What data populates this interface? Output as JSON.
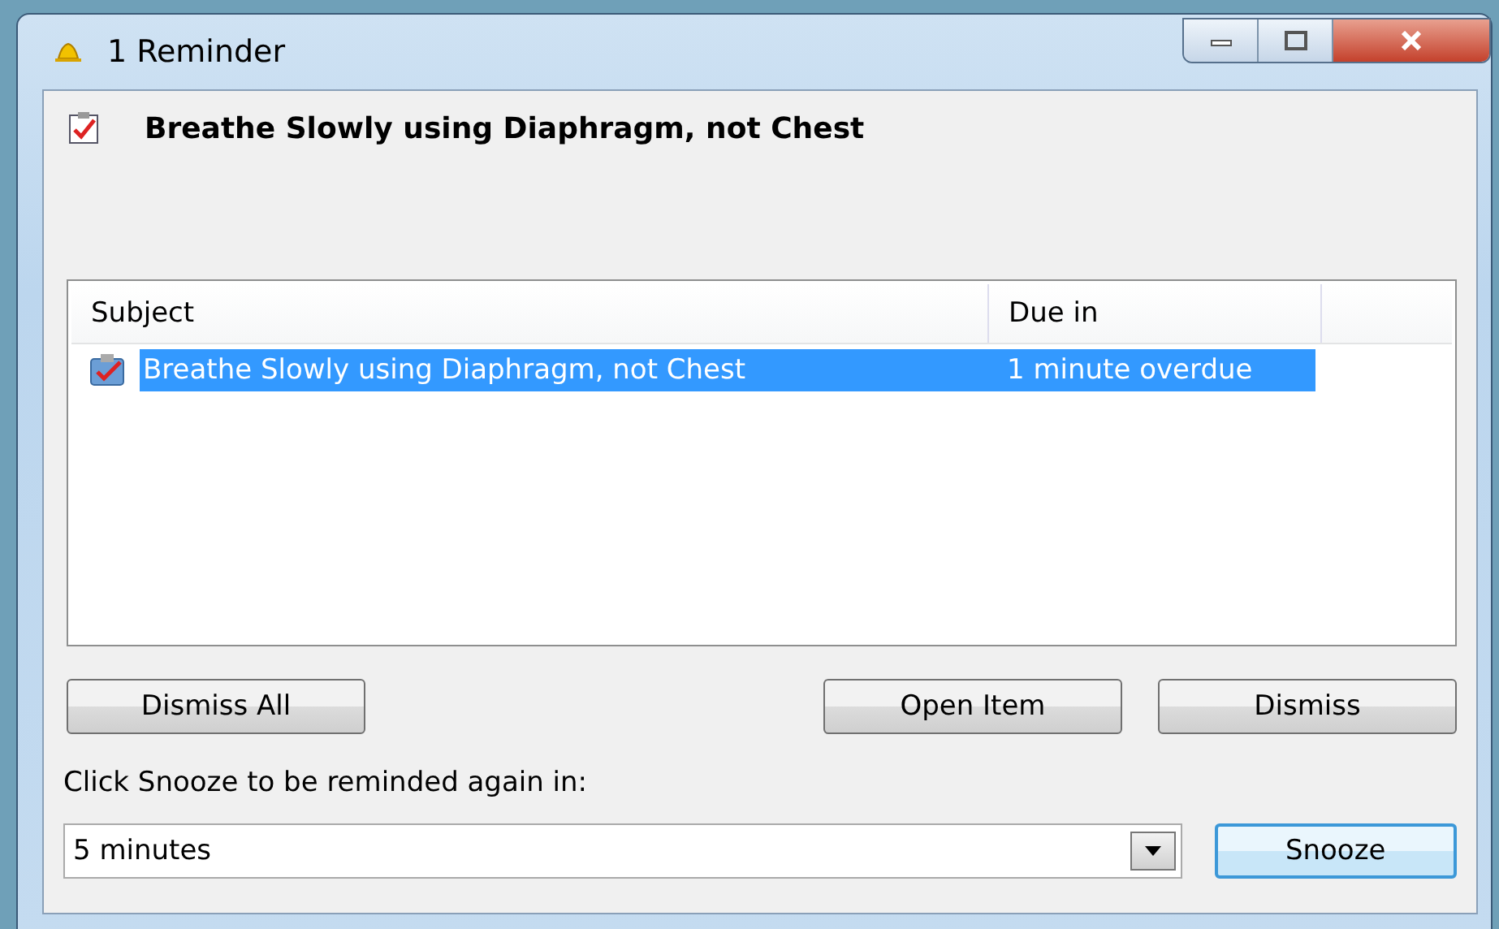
{
  "window": {
    "title": "1 Reminder"
  },
  "header": {
    "subject": "Breathe Slowly using Diaphragm, not Chest"
  },
  "table": {
    "columns": [
      "Subject",
      "Due in"
    ],
    "rows": [
      {
        "subject": "Breathe Slowly using Diaphragm, not Chest",
        "due": "1 minute overdue",
        "selected": true
      }
    ]
  },
  "buttons": {
    "dismiss_all": "Dismiss All",
    "open_item": "Open Item",
    "dismiss": "Dismiss"
  },
  "snooze": {
    "label": "Click Snooze to be reminded again in:",
    "value": "5 minutes",
    "button": "Snooze"
  }
}
